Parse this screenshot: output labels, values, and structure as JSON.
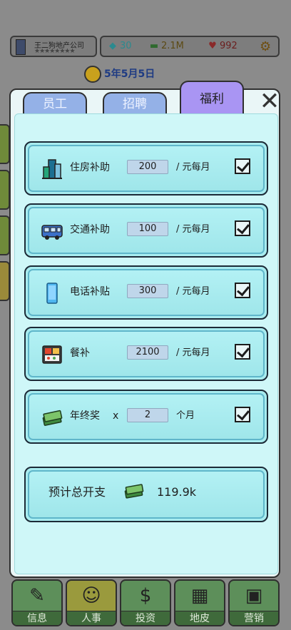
{
  "header": {
    "company_name": "王二狗地产公司",
    "company_stars": "★★★★★★★★",
    "gems": "30",
    "money": "2.1M",
    "hearts": "992",
    "date": "5年5月5日"
  },
  "tabs": [
    {
      "label": "员工"
    },
    {
      "label": "招聘"
    },
    {
      "label": "福利"
    }
  ],
  "benefits": [
    {
      "icon": "building-icon",
      "label": "住房补助",
      "value": "200",
      "unit": "/ 元每月",
      "checked": true
    },
    {
      "icon": "bus-icon",
      "label": "交通补助",
      "value": "100",
      "unit": "/ 元每月",
      "checked": true
    },
    {
      "icon": "phone-icon",
      "label": "电话补贴",
      "value": "300",
      "unit": "/ 元每月",
      "checked": true
    },
    {
      "icon": "meal-icon",
      "label": "餐补",
      "value": "2100",
      "unit": "/ 元每月",
      "checked": true
    },
    {
      "icon": "cash-icon",
      "label": "年终奖",
      "multiplier": "x",
      "value": "2",
      "unit": "个月",
      "checked": true
    }
  ],
  "summary": {
    "label": "预计总开支",
    "value": "119.9k"
  },
  "bottom_nav": [
    {
      "label": "信息"
    },
    {
      "label": "人事"
    },
    {
      "label": "投资"
    },
    {
      "label": "地皮"
    },
    {
      "label": "营销"
    }
  ],
  "colors": {
    "tab_active": "#a995f3",
    "tab_inactive": "#94b1e7",
    "panel": "#cff7f8",
    "row": "#a8ecef"
  }
}
